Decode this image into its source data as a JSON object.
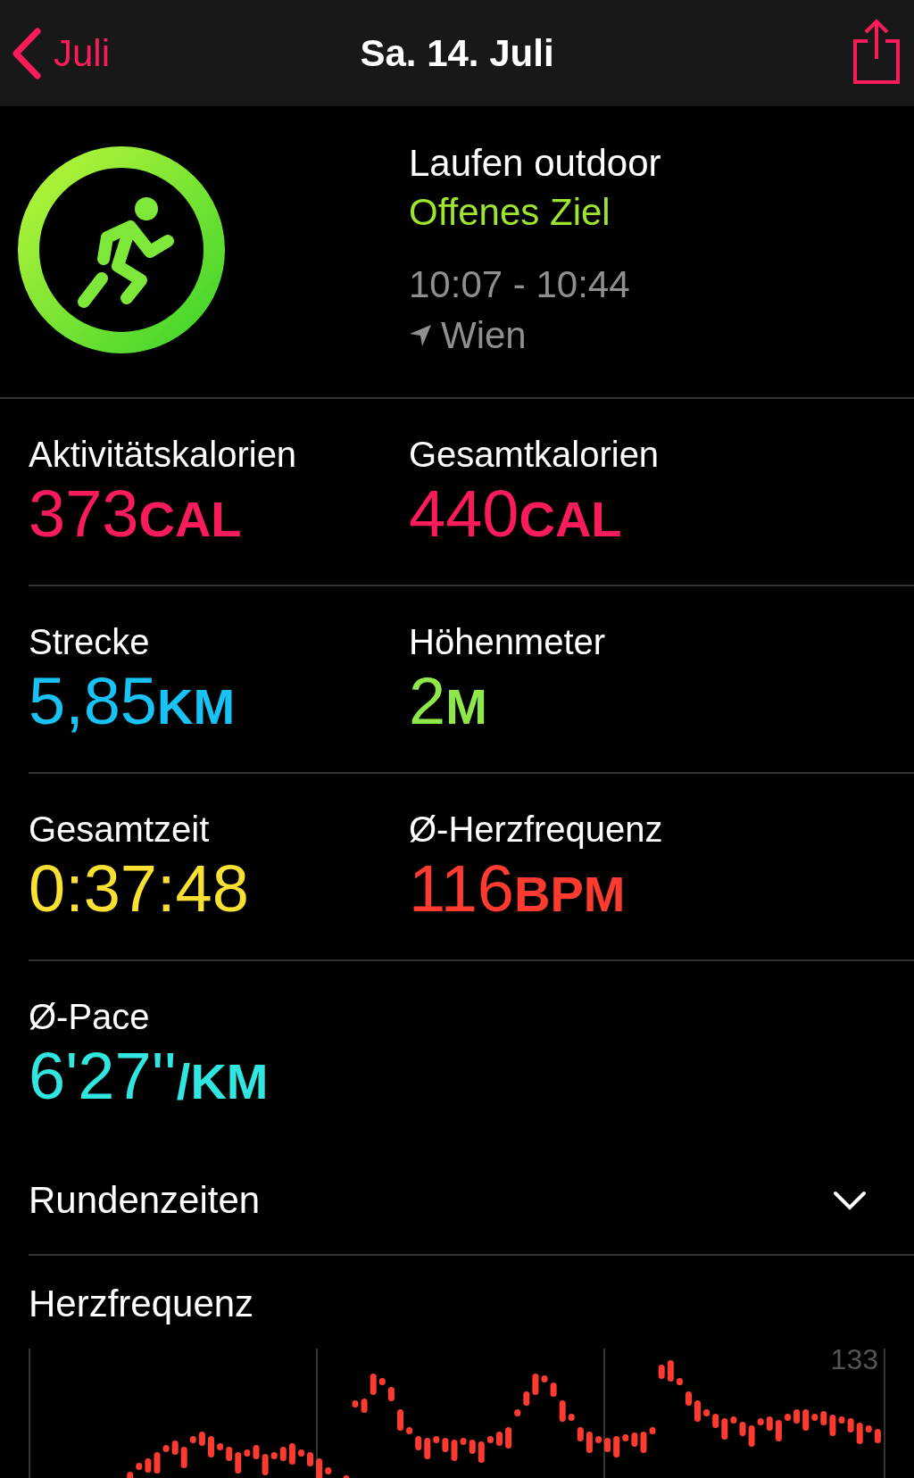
{
  "nav": {
    "back_label": "Juli",
    "title": "Sa. 14. Juli"
  },
  "workout": {
    "name": "Laufen outdoor",
    "goal": "Offenes Ziel",
    "time_range": "10:07 - 10:44",
    "location": "Wien"
  },
  "metrics": [
    [
      {
        "label": "Aktivitätskalorien",
        "value": "373",
        "unit": "CAL",
        "color": "#fa1c5a"
      },
      {
        "label": "Gesamtkalorien",
        "value": "440",
        "unit": "CAL",
        "color": "#fa1c5a"
      }
    ],
    [
      {
        "label": "Strecke",
        "value": "5,85",
        "unit": "KM",
        "color": "#19c2f5"
      },
      {
        "label": "Höhenmeter",
        "value": "2",
        "unit": "M",
        "color": "#8fe84a"
      }
    ],
    [
      {
        "label": "Gesamtzeit",
        "value": "0:37:48",
        "color": "#f9e033"
      },
      {
        "label": "Ø-Herzfrequenz",
        "value": "116",
        "unit": "BPM",
        "color": "#ff3b30"
      }
    ],
    [
      {
        "label": "Ø-Pace",
        "value": "6'27''",
        "unit": "/KM",
        "color": "#31e6e1"
      }
    ]
  ],
  "laps": {
    "label": "Rundenzeiten",
    "expanded": false
  },
  "heart_rate": {
    "title": "Herzfrequenz",
    "max_label": "133"
  }
}
